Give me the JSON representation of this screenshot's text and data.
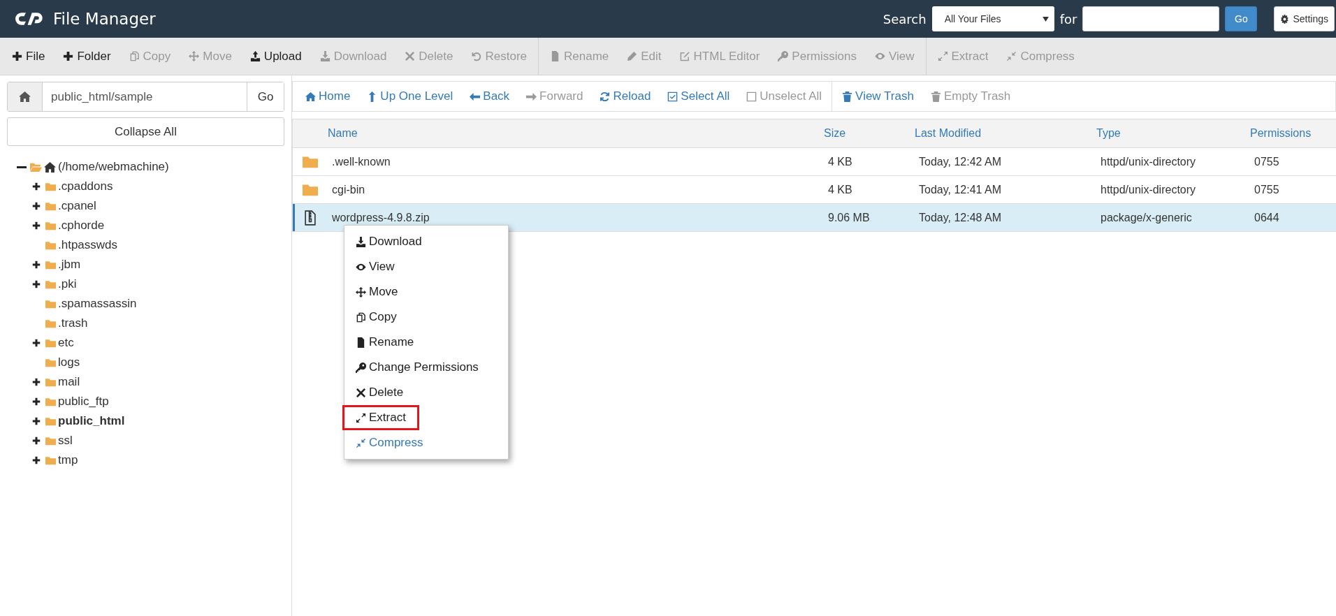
{
  "header": {
    "title": "File Manager",
    "search_label": "Search",
    "scope": "All Your Files",
    "for_label": "for",
    "go": "Go",
    "settings": "Settings"
  },
  "toolbar": [
    {
      "items": [
        {
          "label": "File",
          "disabled": false
        },
        {
          "label": "Folder",
          "disabled": false
        },
        {
          "label": "Copy",
          "disabled": true
        },
        {
          "label": "Move",
          "disabled": true
        },
        {
          "label": "Upload",
          "disabled": false
        },
        {
          "label": "Download",
          "disabled": true
        },
        {
          "label": "Delete",
          "disabled": true
        },
        {
          "label": "Restore",
          "disabled": true
        }
      ]
    },
    {
      "items": [
        {
          "label": "Rename",
          "disabled": true
        },
        {
          "label": "Edit",
          "disabled": true
        },
        {
          "label": "HTML Editor",
          "disabled": true
        },
        {
          "label": "Permissions",
          "disabled": true
        },
        {
          "label": "View",
          "disabled": true
        }
      ]
    },
    {
      "items": [
        {
          "label": "Extract",
          "disabled": true
        },
        {
          "label": "Compress",
          "disabled": true
        }
      ]
    }
  ],
  "path_bar": {
    "value": "public_html/sample",
    "go": "Go"
  },
  "collapse_all": "Collapse All",
  "tree": {
    "label": "(/home/webmachine)",
    "expanded": true,
    "children": [
      {
        "label": ".cpaddons",
        "expandable": true,
        "selected": false
      },
      {
        "label": ".cpanel",
        "expandable": true,
        "selected": false
      },
      {
        "label": ".cphorde",
        "expandable": true,
        "selected": false
      },
      {
        "label": ".htpasswds",
        "expandable": false,
        "selected": false
      },
      {
        "label": ".jbm",
        "expandable": true,
        "selected": false
      },
      {
        "label": ".pki",
        "expandable": true,
        "selected": false
      },
      {
        "label": ".spamassassin",
        "expandable": false,
        "selected": false
      },
      {
        "label": ".trash",
        "expandable": false,
        "selected": false
      },
      {
        "label": "etc",
        "expandable": true,
        "selected": false
      },
      {
        "label": "logs",
        "expandable": false,
        "selected": false
      },
      {
        "label": "mail",
        "expandable": true,
        "selected": false
      },
      {
        "label": "public_ftp",
        "expandable": true,
        "selected": false
      },
      {
        "label": "public_html",
        "expandable": true,
        "selected": true
      },
      {
        "label": "ssl",
        "expandable": true,
        "selected": false
      },
      {
        "label": "tmp",
        "expandable": true,
        "selected": false
      }
    ]
  },
  "nav": [
    {
      "items": [
        {
          "label": "Home",
          "disabled": false
        },
        {
          "label": "Up One Level",
          "disabled": false
        },
        {
          "label": "Back",
          "disabled": false
        },
        {
          "label": "Forward",
          "disabled": true
        },
        {
          "label": "Reload",
          "disabled": false
        },
        {
          "label": "Select All",
          "disabled": false
        },
        {
          "label": "Unselect All",
          "disabled": true
        }
      ]
    },
    {
      "items": [
        {
          "label": "View Trash",
          "disabled": false
        },
        {
          "label": "Empty Trash",
          "disabled": true
        }
      ]
    }
  ],
  "table": {
    "columns": [
      "Name",
      "Size",
      "Last Modified",
      "Type",
      "Permissions"
    ],
    "rows": [
      {
        "kind": "folder",
        "name": ".well-known",
        "size": "4 KB",
        "modified": "Today, 12:42 AM",
        "type": "httpd/unix-directory",
        "permissions": "0755",
        "selected": false
      },
      {
        "kind": "folder",
        "name": "cgi-bin",
        "size": "4 KB",
        "modified": "Today, 12:41 AM",
        "type": "httpd/unix-directory",
        "permissions": "0755",
        "selected": false
      },
      {
        "kind": "archive",
        "name": "wordpress-4.9.8.zip",
        "size": "9.06 MB",
        "modified": "Today, 12:48 AM",
        "type": "package/x-generic",
        "permissions": "0644",
        "selected": true
      }
    ]
  },
  "context_menu": [
    {
      "label": "Download",
      "highlighted": false,
      "active": false
    },
    {
      "label": "View",
      "highlighted": false,
      "active": false
    },
    {
      "label": "Move",
      "highlighted": false,
      "active": false
    },
    {
      "label": "Copy",
      "highlighted": false,
      "active": false
    },
    {
      "label": "Rename",
      "highlighted": false,
      "active": false
    },
    {
      "label": "Change Permissions",
      "highlighted": false,
      "active": false
    },
    {
      "label": "Delete",
      "highlighted": false,
      "active": false
    },
    {
      "label": "Extract",
      "highlighted": true,
      "active": false
    },
    {
      "label": "Compress",
      "highlighted": false,
      "active": true
    }
  ]
}
